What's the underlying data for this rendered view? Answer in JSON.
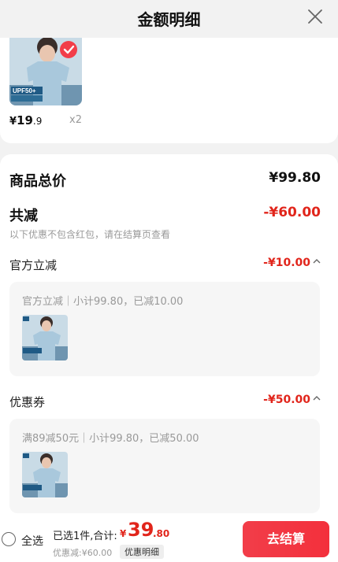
{
  "header": {
    "title": "金额明细",
    "close_icon": "close-icon"
  },
  "product": {
    "image_icon": "tshirt-product-image",
    "price_currency": "¥",
    "price_int": "19",
    "price_dec": ".9",
    "quantity": "x2",
    "checked_icon": "check-icon"
  },
  "summary": {
    "goods_total_label": "商品总价",
    "goods_total_value": "¥99.80",
    "total_reduction_label": "共减",
    "total_reduction_value": "-¥60.00",
    "reduction_note": "以下优惠不包含红包，请在结算页查看"
  },
  "official": {
    "label": "官方立减",
    "value": "-¥10.00",
    "detail": "官方立减｜小计99.80，已减10.00"
  },
  "coupon": {
    "label": "优惠券",
    "value": "-¥50.00",
    "detail": "满89减50元｜小计99.80，已减50.00"
  },
  "bottom_bar": {
    "select_all": "全选",
    "selected_text": "已选1件,合计:",
    "total_currency": "¥",
    "total_int": "39",
    "total_dec": ".80",
    "discount_text": "优惠减:¥60.00",
    "detail_tag": "优惠明细",
    "checkout_button": "去结算"
  },
  "colors": {
    "accent": "#e1251b",
    "button": "#f23d49"
  }
}
